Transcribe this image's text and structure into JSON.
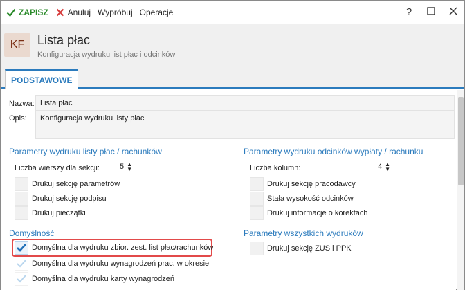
{
  "toolbar": {
    "save": "ZAPISZ",
    "cancel": "Anuluj",
    "try": "Wypróbuj",
    "operations": "Operacje"
  },
  "window": {
    "help": "?"
  },
  "header": {
    "badge": "KF",
    "title": "Lista płac",
    "subtitle": "Konfiguracja wydruku list płac i odcinków"
  },
  "tabs": [
    {
      "label": "PODSTAWOWE",
      "active": true
    }
  ],
  "form": {
    "name_label": "Nazwa:",
    "name_value": "Lista płac",
    "desc_label": "Opis:",
    "desc_value": "Konfiguracja wydruku listy płac"
  },
  "left_section": {
    "title": "Parametry wydruku listy płac / rachunków",
    "rows_label": "Liczba wierszy dla sekcji:",
    "rows_value": "5",
    "checks": [
      {
        "label": "Drukuj sekcję parametrów",
        "checked": false
      },
      {
        "label": "Drukuj sekcję podpisu",
        "checked": false
      },
      {
        "label": "Drukuj pieczątki",
        "checked": false
      }
    ]
  },
  "right_section": {
    "title": "Parametry wydruku odcinków wypłaty / rachunku",
    "cols_label": "Liczba kolumn:",
    "cols_value": "4",
    "checks": [
      {
        "label": "Drukuj sekcję pracodawcy",
        "checked": false
      },
      {
        "label": "Stała wysokość odcinków",
        "checked": false
      },
      {
        "label": "Drukuj informacje o korektach",
        "checked": false
      }
    ]
  },
  "defaults_section": {
    "title": "Domyślność",
    "checks": [
      {
        "label": "Domyślna dla wydruku zbior. zest. list płac/rachunków",
        "checked": true
      },
      {
        "label": "Domyślna dla wydruku wynagrodzeń prac. w okresie",
        "checked": true
      },
      {
        "label": "Domyślna dla wydruku karty wynagrodzeń",
        "checked": true
      }
    ]
  },
  "all_prints_section": {
    "title": "Parametry wszystkich wydruków",
    "checks": [
      {
        "label": "Drukuj sekcję ZUS i PPK",
        "checked": false
      }
    ]
  },
  "colors": {
    "accent": "#2b7bbd",
    "save_green": "#2a8a2a",
    "cancel_red": "#d63a3a",
    "highlight_red": "#e24a4a"
  }
}
